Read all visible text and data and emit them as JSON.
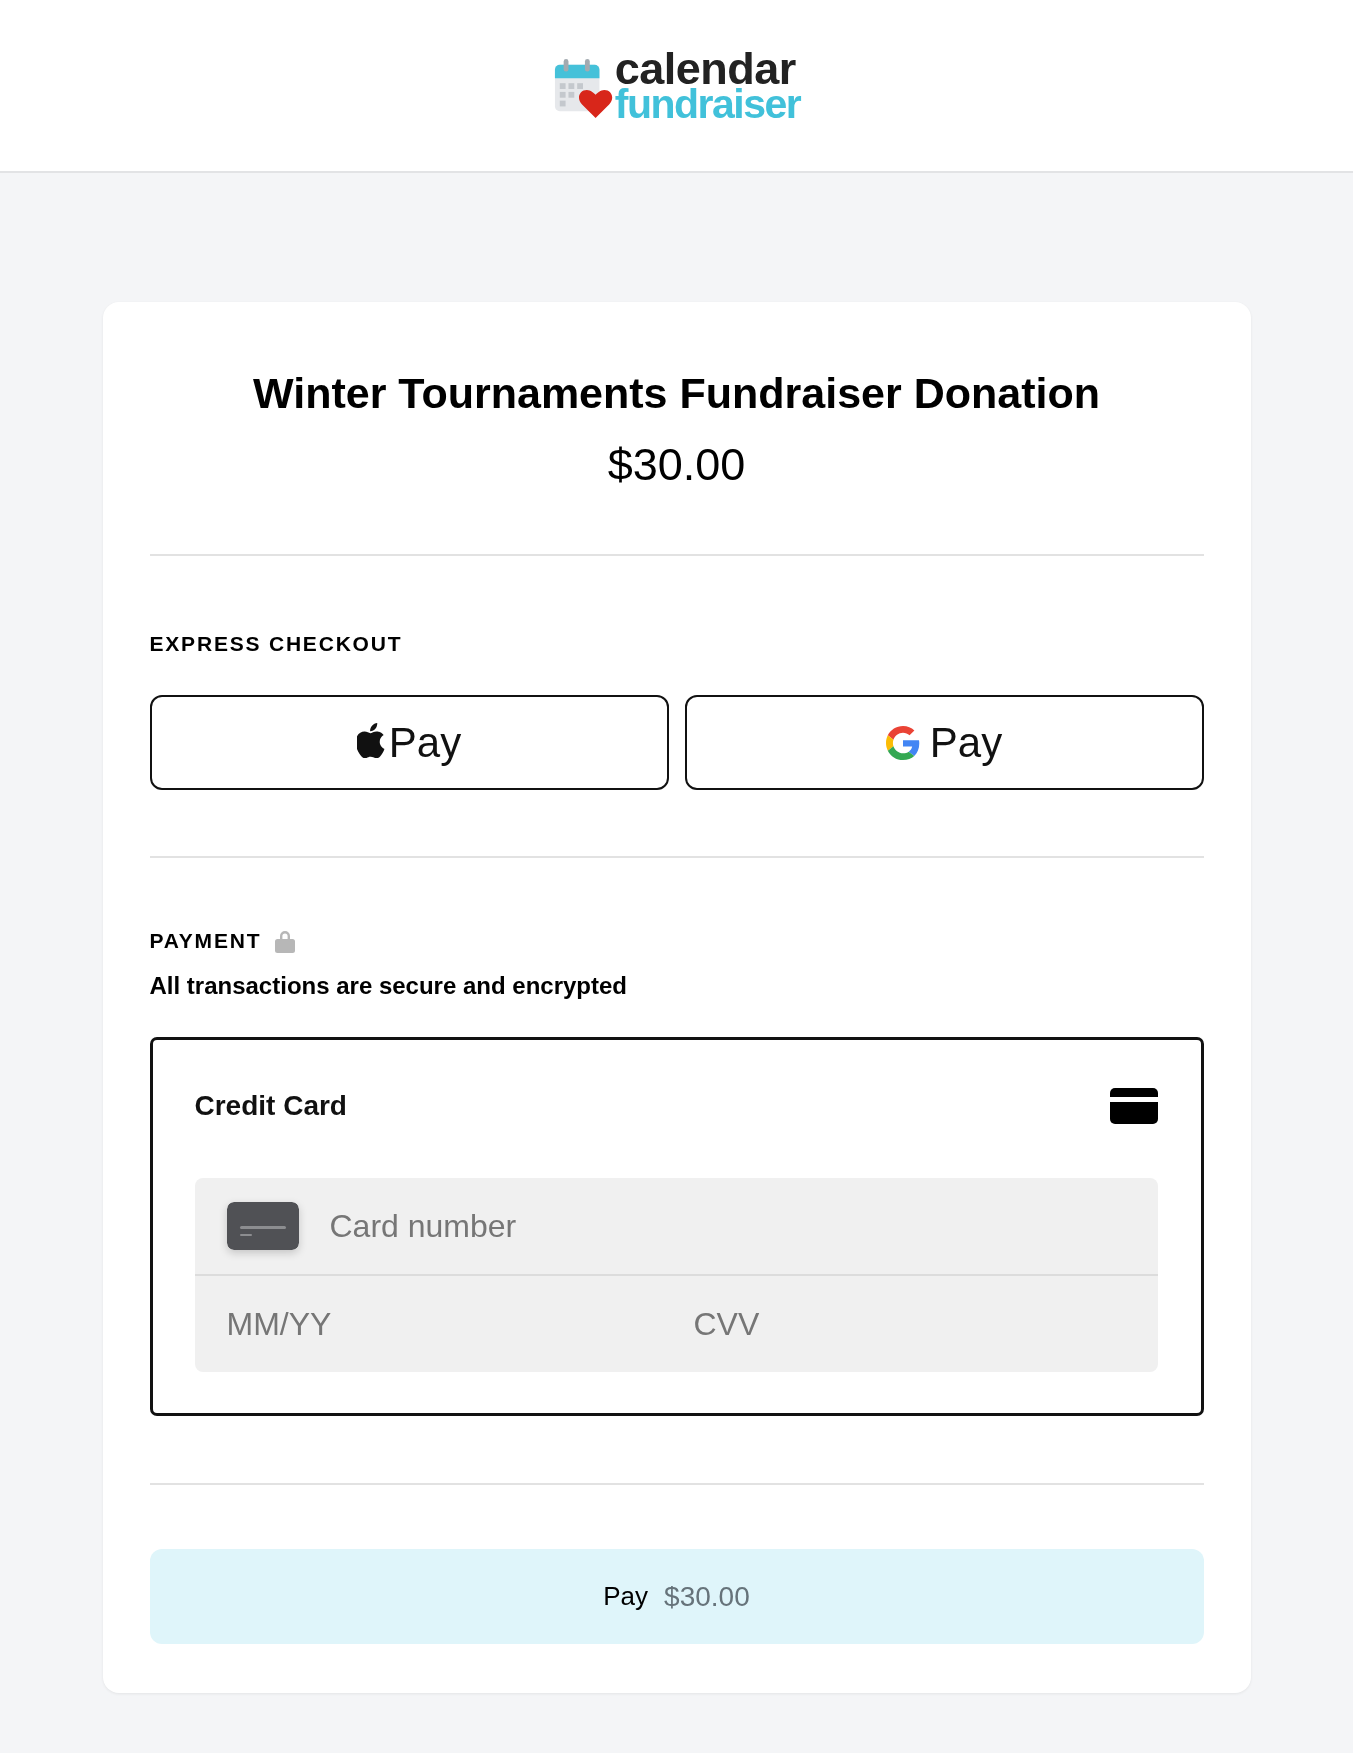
{
  "header": {
    "logo": {
      "title": "calendar",
      "subtitle": "fundraiser"
    }
  },
  "summary": {
    "title": "Winter Tournaments Fundraiser Donation",
    "amount": "$30.00"
  },
  "express_checkout": {
    "heading": "EXPRESS CHECKOUT",
    "buttons": [
      {
        "kind": "apple",
        "label": "Pay"
      },
      {
        "kind": "google",
        "label": "Pay"
      }
    ]
  },
  "payment": {
    "heading": "PAYMENT",
    "note": "All transactions are secure and encrypted",
    "method": {
      "title": "Credit Card",
      "card_number": {
        "placeholder": "Card number"
      },
      "expiry": {
        "placeholder": "MM/YY"
      },
      "cvv": {
        "placeholder": "CVV"
      }
    }
  },
  "pay_button": {
    "label": "Pay",
    "amount": "$30.00"
  }
}
